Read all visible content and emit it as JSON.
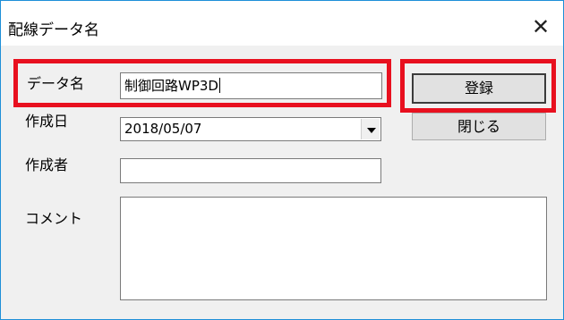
{
  "window": {
    "title": "配線データ名",
    "close_glyph": "✕"
  },
  "form": {
    "name_label": "データ名",
    "name_value": "制御回路WP3D",
    "date_label": "作成日",
    "date_value": "2018/05/07",
    "author_label": "作成者",
    "author_value": "",
    "comment_label": "コメント",
    "comment_value": ""
  },
  "buttons": {
    "register": "登録",
    "close": "閉じる"
  },
  "colors": {
    "highlight": "#e8101f",
    "window_border": "#1e8fd8",
    "dialog_bg": "#f0f0f0"
  }
}
